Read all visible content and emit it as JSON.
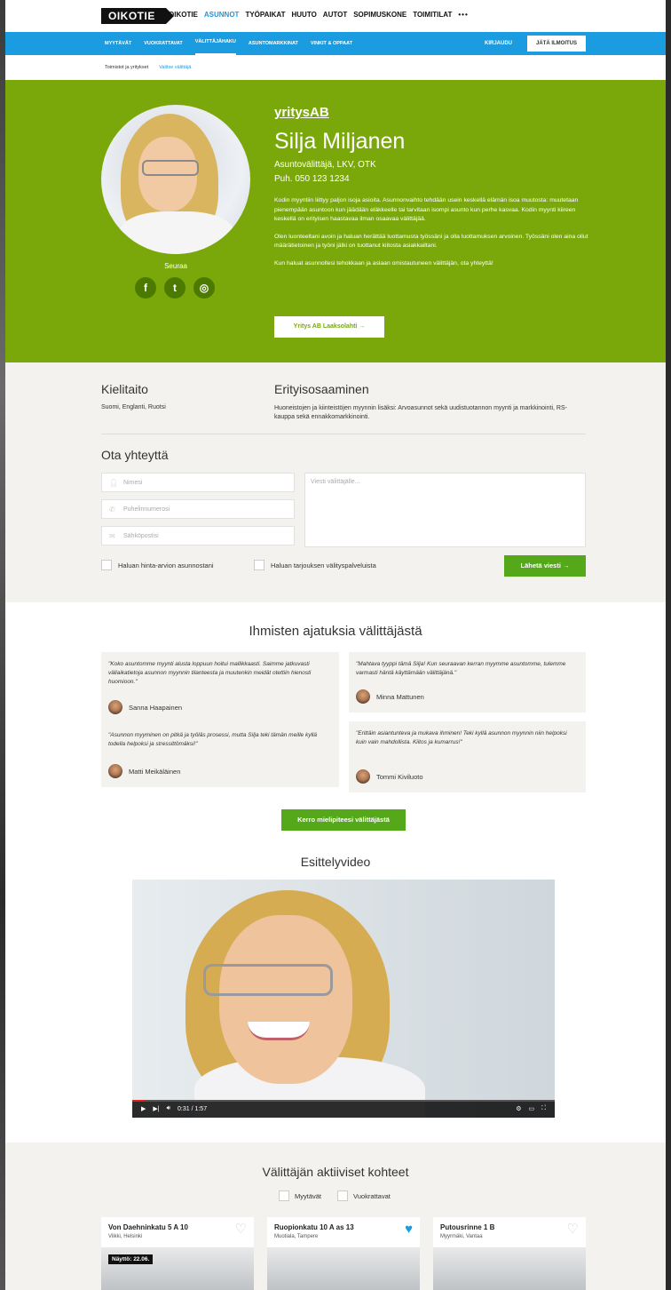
{
  "brand": "OIKOTIE",
  "top_nav": [
    "OIKOTIE",
    "ASUNNOT",
    "TYÖPAIKAT",
    "HUUTO",
    "AUTOT",
    "SOPIMUSKONE",
    "TOIMITILAT",
    "•••"
  ],
  "top_nav_active": "ASUNNOT",
  "sub_nav": [
    "MYYTÄVÄT",
    "VUOKRATTAVAT",
    "VÄLITTÄJÄHAKU",
    "ASUNTOMARKKINAT",
    "VINKIT & OPPAAT"
  ],
  "sub_nav_active": "VÄLITTÄJÄHAKU",
  "login": "KIRJAUDU",
  "leave_ad": "JÄTÄ ILMOITUS",
  "breadcrumb": {
    "first": "Toimistot ja yritykset",
    "second": "Valitse välittäjä"
  },
  "agent": {
    "company": "yritysAB",
    "name": "Silja Miljanen",
    "title": "Asuntovälittäjä, LKV, OTK",
    "phone": "Puh. 050 123 1234",
    "bio": [
      "Kodin myyntiin liittyy paljon isoja asioita. Asunnonvaihto tehdään usein keskellä elämän isoa muutosta: muutetaan pienempään asuntoon kun jäädään eläkkeelle tai tarvitaan isompi asunto kun perhe kasvaa. Kodin myynti kiireen keskellä on erityisen haastavaa ilman osaavaa välittäjää.",
      "Olen luonteeltani avoin ja haluan herättää luottamusta työssäni ja olla luottamuksen arvoinen. Työssäni olen aina ollut määrätietoinen ja työni jälki on tuottanut kiitosta asiakkailtani.",
      "Kun haluat asunnollesi tehokkaan ja asiaan omistautuneen välittäjän, ota yhteyttä!"
    ],
    "follow": "Seuraa",
    "social_icons": [
      "facebook-icon",
      "twitter-icon",
      "instagram-icon"
    ],
    "office_button": "Yritys AB Laaksolahti →"
  },
  "info": {
    "languages_heading": "Kielitaito",
    "languages": "Suomi, Englanti, Ruotsi",
    "expertise_heading": "Erityisosaaminen",
    "expertise": "Huoneistojen ja kiinteistöjen myynnin lisäksi: Arvoasunnot sekä uudistuotannon myynti ja markkinointi, RS-kauppa sekä ennakkomarkkinointi."
  },
  "contact": {
    "heading": "Ota yhteyttä",
    "name_placeholder": "Nimesi",
    "phone_placeholder": "Puhelinnumerosi",
    "email_placeholder": "Sähköpostisi",
    "message_placeholder": "Viesti välittäjälle...",
    "checkbox_estimate": "Haluan hinta-arvion asunnostani",
    "checkbox_offer": "Haluan tarjouksen välityspalveluista",
    "send": "Lähetä viesti  →"
  },
  "reviews": {
    "heading": "Ihmisten ajatuksia välittäjästä",
    "items": [
      {
        "text": "\"Koko asuntomme myynti alusta loppuun hoitui mallikkaasti. Saimme jatkuvasti väliaikatietoja asunnon myynnin tilanteesta ja muutenkin meidät otettiin hienosti huomioon.\"",
        "author": "Sanna Haapainen"
      },
      {
        "text": "\"Mahtava tyyppi tämä Silja! Kun seuraavan kerran myymme asuntomme, tulemme varmasti häntä käyttämään välittäjänä.\"",
        "author": "Minna Mattunen"
      },
      {
        "text": "\"Asunnon myyminen on pitkä ja työläs prosessi, mutta Silja teki tämän meille kyllä todella helpoksi ja stressittömäksi!\"",
        "author": "Matti Meikäläinen"
      },
      {
        "text": "\"Erittäin asiantunteva ja mukava ihminen! Teki kyllä asunnon myynnin niin helpoksi kuin vain mahdollista. Kiitos ja kumarrus!\"",
        "author": "Tommi Kiviluoto"
      }
    ],
    "button": "Kerro mielipiteesi välittäjästä"
  },
  "video": {
    "heading": "Esittelyvideo",
    "time": "0:31 / 1:57",
    "progress_fraction": 0.03
  },
  "listings": {
    "heading": "Välittäjän aktiiviset kohteet",
    "filter_sale": "Myytävät",
    "filter_rent": "Vuokrattavat",
    "items": [
      {
        "street": "Von Daehninkatu 5 A 10",
        "city": "Viikki, Helsinki",
        "badge": "Näyttö: 22.06.",
        "favorite": false
      },
      {
        "street": "Ruopionkatu 10 A as 13",
        "city": "Muotiala, Tampere",
        "badge": "",
        "favorite": true
      },
      {
        "street": "Putousrinne 1 B",
        "city": "Myyrmäki, Vantaa",
        "badge": "",
        "favorite": false
      }
    ]
  },
  "colors": {
    "accent_blue": "#1b9be0",
    "hero_green": "#7aa80b",
    "button_green": "#55a819"
  }
}
